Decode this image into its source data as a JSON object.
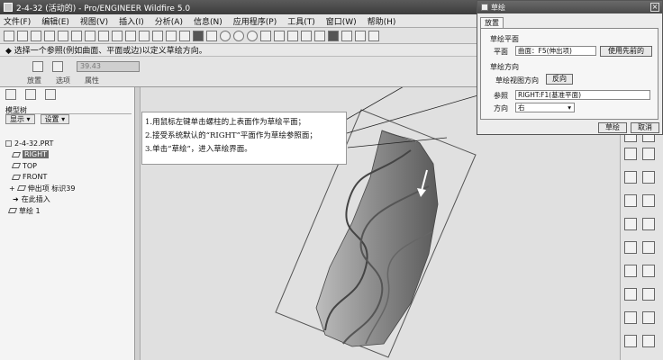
{
  "window": {
    "title": "2-4-32 (活动的) - Pro/ENGINEER Wildfire 5.0"
  },
  "menu": [
    "文件(F)",
    "编辑(E)",
    "视图(V)",
    "插入(I)",
    "分析(A)",
    "信息(N)",
    "应用程序(P)",
    "工具(T)",
    "窗口(W)",
    "帮助(H)"
  ],
  "message": {
    "text": "◆ 选择一个参照(例如曲面、平面或边)以定义草绘方向。"
  },
  "dashboard": {
    "field_value": "39.43",
    "tabs": [
      "放置",
      "选项",
      "属性"
    ]
  },
  "left_panel": {
    "title": "模型树",
    "display_btn": "显示 ▾",
    "settings_btn": "设置 ▾",
    "tree": [
      {
        "label": "2-4-32.PRT"
      },
      {
        "label": "RIGHT"
      },
      {
        "label": "TOP"
      },
      {
        "label": "FRONT"
      },
      {
        "label": "伸出项 标识39"
      },
      {
        "label": "在此插入"
      },
      {
        "label": "草绘 1"
      }
    ]
  },
  "callout": {
    "line1": "1.用鼠标左键单击螺柱的上表面作为草绘平面；",
    "line2": "2.接受系统默认的“RIGHT”平面作为草绘参照面；",
    "line3": "3.单击“草绘”，进入草绘界面。"
  },
  "dialog": {
    "title": "草绘",
    "tab": "放置",
    "section1": "草绘平面",
    "plane_label": "平面",
    "plane_value": "曲面：F5(伸出项)",
    "use_prev_btn": "使用先前的",
    "section2": "草绘方向",
    "view_dir_label": "草绘视图方向",
    "flip_btn": "反向",
    "ref_label": "参照",
    "ref_value": "RIGHT:F1(基准平面)",
    "orient_label": "方向",
    "orient_value": "右",
    "sketch_btn": "草绘",
    "cancel_btn": "取消"
  },
  "colors": {
    "titlebar": "#4a4a4a",
    "model": "#8a8a8a",
    "selection": "#6a6a6a"
  }
}
